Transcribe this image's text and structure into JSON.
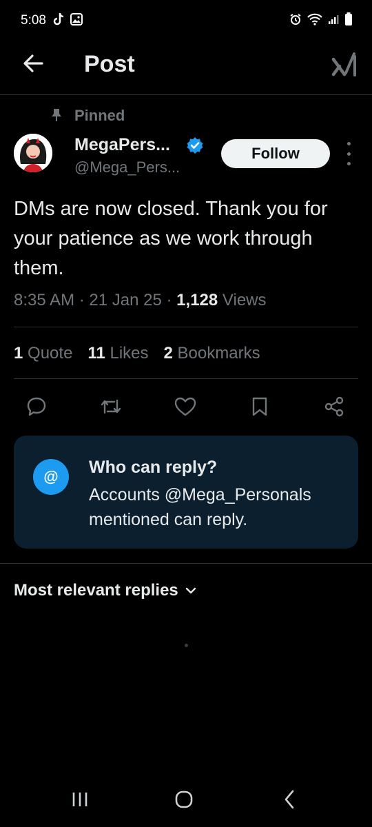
{
  "status_bar": {
    "time": "5:08"
  },
  "header": {
    "title": "Post"
  },
  "post": {
    "pinned_label": "Pinned",
    "display_name": "MegaPers...",
    "handle": "@Mega_Pers...",
    "follow_label": "Follow",
    "text": "DMs are now closed. Thank you for your patience as we work through them.",
    "time": "8:35 AM",
    "date": "21 Jan 25",
    "views_count": "1,128",
    "views_label": "Views",
    "sep": "·"
  },
  "stats": {
    "quotes_count": "1",
    "quotes_label": "Quote",
    "likes_count": "11",
    "likes_label": "Likes",
    "bookmarks_count": "2",
    "bookmarks_label": "Bookmarks"
  },
  "reply_settings": {
    "title": "Who can reply?",
    "body": "Accounts @Mega_Personals mentioned can reply.",
    "icon_text": "@"
  },
  "replies_sort": {
    "label": "Most relevant replies"
  },
  "colors": {
    "accent": "#1d9bf0",
    "muted": "#71767b",
    "card": "#0b1f2e"
  }
}
